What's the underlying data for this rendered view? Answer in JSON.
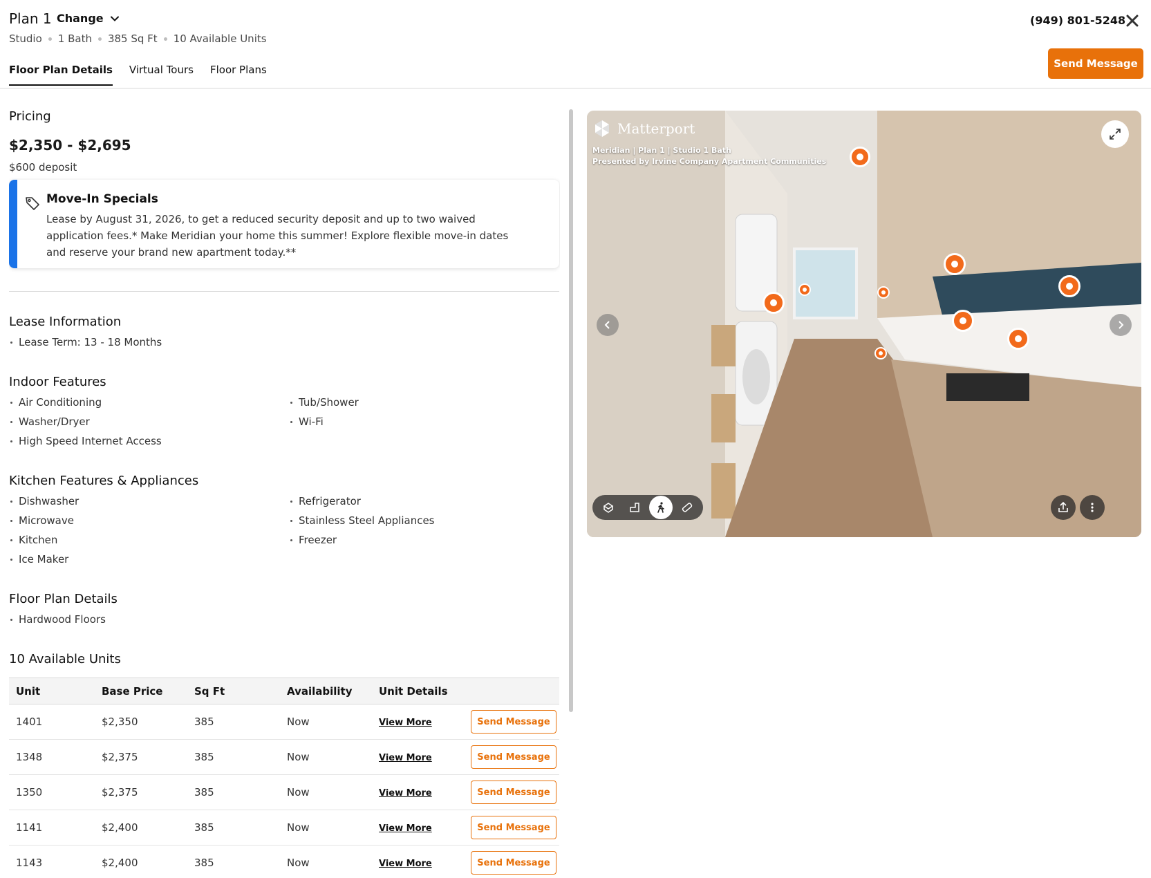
{
  "header": {
    "plan_title": "Plan 1",
    "change_label": "Change",
    "meta": [
      "Studio",
      "1 Bath",
      "385 Sq Ft",
      "10 Available Units"
    ],
    "phone": "(949) 801-5248",
    "send_message_label": "Send Message",
    "tabs": [
      {
        "label": "Floor Plan Details",
        "active": true
      },
      {
        "label": "Virtual Tours",
        "active": false
      },
      {
        "label": "Floor Plans",
        "active": false
      }
    ]
  },
  "pricing": {
    "title": "Pricing",
    "range": "$2,350 - $2,695",
    "deposit": "$600 deposit"
  },
  "special": {
    "title": "Move-In Specials",
    "text": "Lease by August 31, 2026, to get a reduced security deposit and up to two waived application fees.* Make Meridian your home this summer! Explore flexible move-in dates and reserve your brand new apartment today.**",
    "accent_color": "#1a73e8"
  },
  "lease": {
    "title": "Lease Information",
    "items": [
      "Lease Term: 13 - 18 Months"
    ]
  },
  "indoor": {
    "title": "Indoor Features",
    "col1": [
      "Air Conditioning",
      "Washer/Dryer",
      "High Speed Internet Access"
    ],
    "col2": [
      "Tub/Shower",
      "Wi-Fi"
    ]
  },
  "kitchen": {
    "title": "Kitchen Features & Appliances",
    "col1": [
      "Dishwasher",
      "Microwave",
      "Kitchen",
      "Ice Maker"
    ],
    "col2": [
      "Refrigerator",
      "Stainless Steel Appliances",
      "Freezer"
    ]
  },
  "floorplan": {
    "title": "Floor Plan Details",
    "items": [
      "Hardwood Floors"
    ]
  },
  "units": {
    "title": "10 Available Units",
    "columns": [
      "Unit",
      "Base Price",
      "Sq Ft",
      "Availability",
      "Unit Details",
      ""
    ],
    "view_more_label": "View More",
    "send_label": "Send Message",
    "rows": [
      {
        "unit": "1401",
        "price": "$2,350",
        "sqft": "385",
        "availability": "Now"
      },
      {
        "unit": "1348",
        "price": "$2,375",
        "sqft": "385",
        "availability": "Now"
      },
      {
        "unit": "1350",
        "price": "$2,375",
        "sqft": "385",
        "availability": "Now"
      },
      {
        "unit": "1141",
        "price": "$2,400",
        "sqft": "385",
        "availability": "Now"
      },
      {
        "unit": "1143",
        "price": "$2,400",
        "sqft": "385",
        "availability": "Now"
      }
    ]
  },
  "tour": {
    "brand": "Matterport",
    "caption_line1": "Meridian | Plan 1 | Studio 1 Bath",
    "caption_line2": "Presented by Irvine Company Apartment Communities",
    "hotspot_color": "#f26a1b"
  },
  "colors": {
    "accent": "#e8710a",
    "special_bar": "#1a73e8"
  }
}
